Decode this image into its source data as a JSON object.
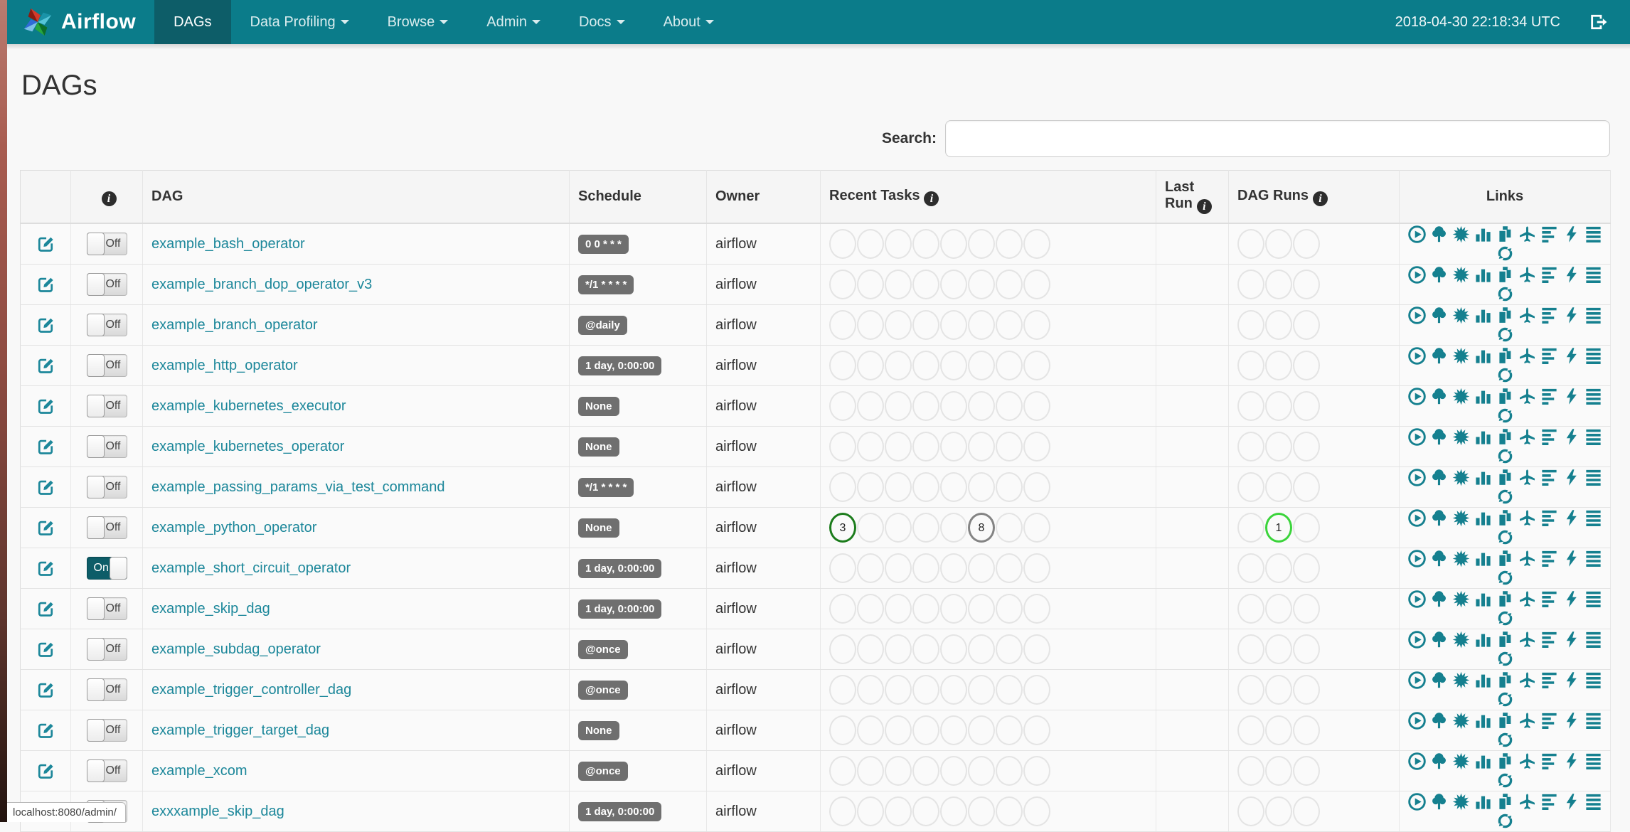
{
  "navbar": {
    "brand": "Airflow",
    "items": [
      {
        "label": "DAGs",
        "active": true,
        "caret": false
      },
      {
        "label": "Data Profiling",
        "active": false,
        "caret": true
      },
      {
        "label": "Browse",
        "active": false,
        "caret": true
      },
      {
        "label": "Admin",
        "active": false,
        "caret": true
      },
      {
        "label": "Docs",
        "active": false,
        "caret": true
      },
      {
        "label": "About",
        "active": false,
        "caret": true
      }
    ],
    "clock": "2018-04-30 22:18:34 UTC"
  },
  "page": {
    "title": "DAGs",
    "search_label": "Search:",
    "search_value": "",
    "status_text": "localhost:8080/admin/"
  },
  "table": {
    "headers": {
      "dag": "DAG",
      "schedule": "Schedule",
      "owner": "Owner",
      "recent_tasks": "Recent Tasks",
      "last_run": "Last Run",
      "dag_runs": "DAG Runs",
      "links": "Links"
    },
    "toggle_on_label": "On",
    "toggle_off_label": "Off",
    "recent_slots": 8,
    "dag_run_slots": 3,
    "links_icons": [
      "play-circle",
      "tree",
      "graph",
      "duration",
      "tries",
      "landing-times",
      "gantt",
      "code",
      "logs",
      "refresh"
    ],
    "rows": [
      {
        "name": "example_bash_operator",
        "toggle": "off",
        "schedule": "0 0 * * *",
        "owner": "airflow",
        "recent": [],
        "runs": []
      },
      {
        "name": "example_branch_dop_operator_v3",
        "toggle": "off",
        "schedule": "*/1 * * * *",
        "owner": "airflow",
        "recent": [],
        "runs": []
      },
      {
        "name": "example_branch_operator",
        "toggle": "off",
        "schedule": "@daily",
        "owner": "airflow",
        "recent": [],
        "runs": []
      },
      {
        "name": "example_http_operator",
        "toggle": "off",
        "schedule": "1 day, 0:00:00",
        "owner": "airflow",
        "recent": [],
        "runs": []
      },
      {
        "name": "example_kubernetes_executor",
        "toggle": "off",
        "schedule": "None",
        "owner": "airflow",
        "recent": [],
        "runs": []
      },
      {
        "name": "example_kubernetes_operator",
        "toggle": "off",
        "schedule": "None",
        "owner": "airflow",
        "recent": [],
        "runs": []
      },
      {
        "name": "example_passing_params_via_test_command",
        "toggle": "off",
        "schedule": "*/1 * * * *",
        "owner": "airflow",
        "recent": [],
        "runs": []
      },
      {
        "name": "example_python_operator",
        "toggle": "off",
        "schedule": "None",
        "owner": "airflow",
        "recent": [
          {
            "slot": 0,
            "count": "3",
            "state": "success"
          },
          {
            "slot": 5,
            "count": "8",
            "state": "queued"
          }
        ],
        "runs": [
          {
            "slot": 1,
            "count": "1",
            "state": "running"
          }
        ]
      },
      {
        "name": "example_short_circuit_operator",
        "toggle": "on",
        "schedule": "1 day, 0:00:00",
        "owner": "airflow",
        "recent": [],
        "runs": []
      },
      {
        "name": "example_skip_dag",
        "toggle": "off",
        "schedule": "1 day, 0:00:00",
        "owner": "airflow",
        "recent": [],
        "runs": []
      },
      {
        "name": "example_subdag_operator",
        "toggle": "off",
        "schedule": "@once",
        "owner": "airflow",
        "recent": [],
        "runs": []
      },
      {
        "name": "example_trigger_controller_dag",
        "toggle": "off",
        "schedule": "@once",
        "owner": "airflow",
        "recent": [],
        "runs": []
      },
      {
        "name": "example_trigger_target_dag",
        "toggle": "off",
        "schedule": "None",
        "owner": "airflow",
        "recent": [],
        "runs": []
      },
      {
        "name": "example_xcom",
        "toggle": "off",
        "schedule": "@once",
        "owner": "airflow",
        "recent": [],
        "runs": []
      },
      {
        "name": "exxxample_skip_dag",
        "toggle": "off",
        "schedule": "1 day, 0:00:00",
        "owner": "airflow",
        "recent": [],
        "runs": []
      }
    ]
  },
  "colors": {
    "accent": "#1c879a",
    "navbar": "#0b7c8a",
    "navbar_active": "#0d5d68",
    "success": "#1c7c1c",
    "queued": "#848484",
    "running": "#3bd43b"
  }
}
